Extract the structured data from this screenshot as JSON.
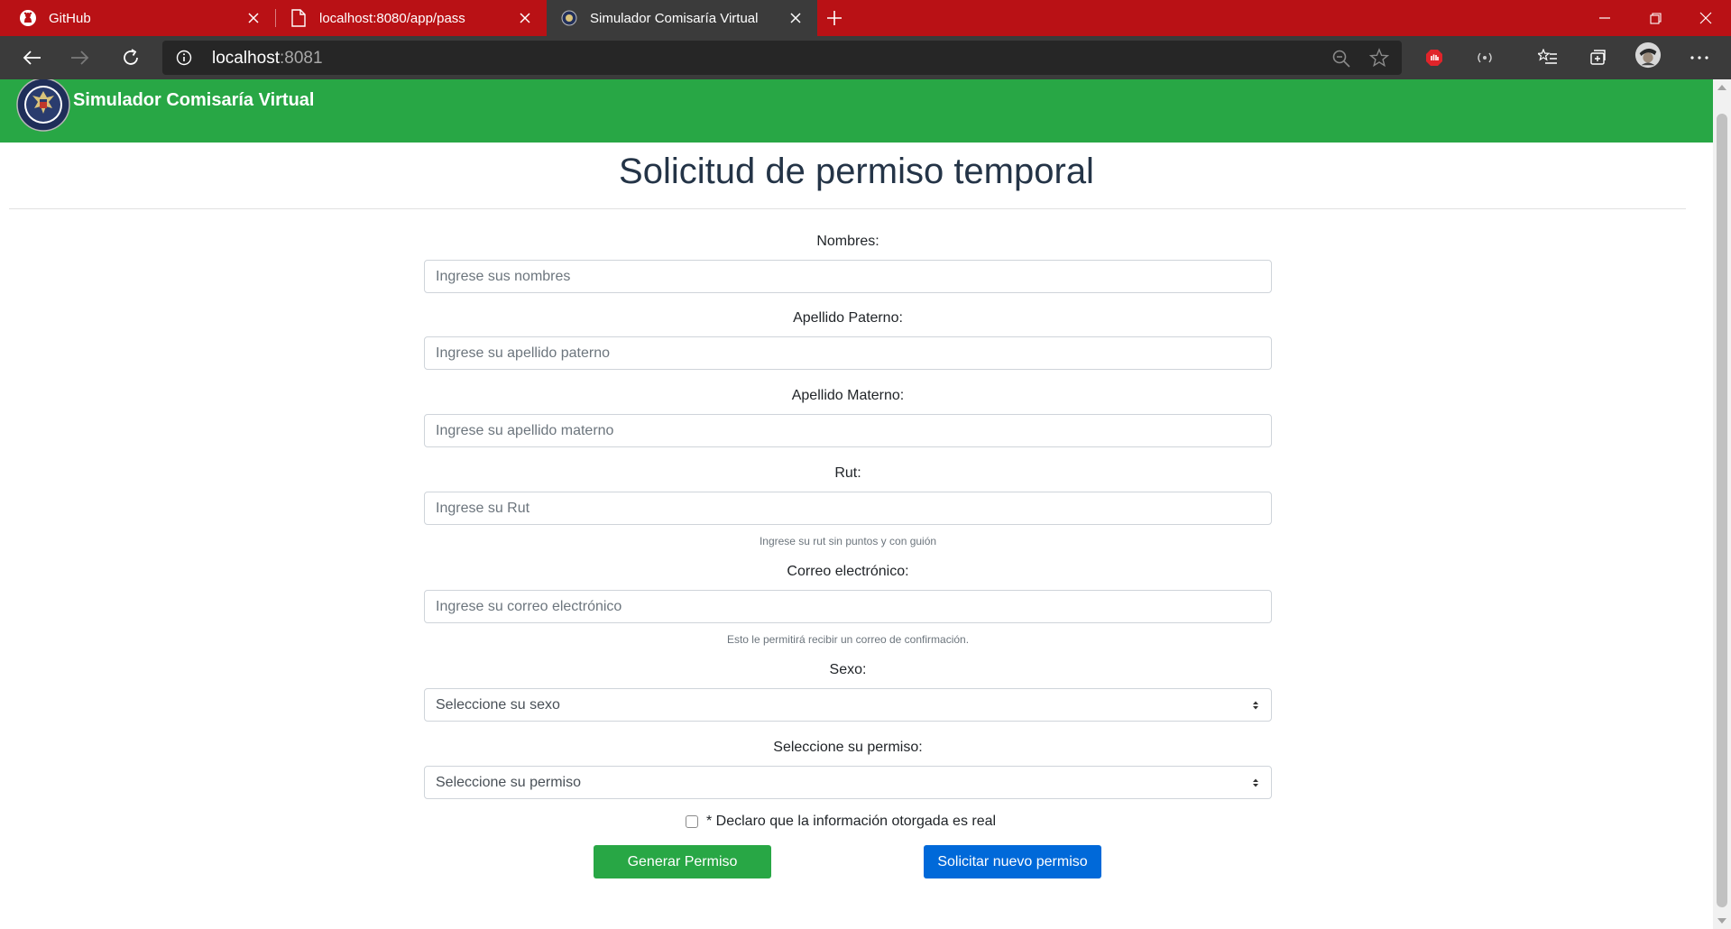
{
  "browser": {
    "tabs": [
      {
        "title": "GitHub",
        "icon": "github-icon"
      },
      {
        "title": "localhost:8080/app/pass",
        "icon": "page-icon"
      },
      {
        "title": "Simulador Comisaría Virtual",
        "icon": "seal-favicon",
        "active": true
      }
    ],
    "address": {
      "host": "localhost",
      "port": ":8081"
    },
    "colors": {
      "tabstrip": "#b91115",
      "toolbar": "#3b3b3b"
    }
  },
  "navbar": {
    "brand": "Simulador Comisaría Virtual",
    "color": "#28a745"
  },
  "page": {
    "title": "Solicitud de permiso temporal"
  },
  "form": {
    "nombres": {
      "label": "Nombres:",
      "placeholder": "Ingrese sus nombres"
    },
    "apellido_paterno": {
      "label": "Apellido Paterno:",
      "placeholder": "Ingrese su apellido paterno"
    },
    "apellido_materno": {
      "label": "Apellido Materno:",
      "placeholder": "Ingrese su apellido materno"
    },
    "rut": {
      "label": "Rut:",
      "placeholder": "Ingrese su Rut",
      "help": "Ingrese su rut sin puntos y con guión"
    },
    "correo": {
      "label": "Correo electrónico:",
      "placeholder": "Ingrese su correo electrónico",
      "help": "Esto le permitirá recibir un correo de confirmación."
    },
    "sexo": {
      "label": "Sexo:",
      "selected": "Seleccione su sexo"
    },
    "permiso": {
      "label": "Seleccione su permiso:",
      "selected": "Seleccione su permiso"
    },
    "declaracion": "* Declaro que la información otorgada es real",
    "buttons": {
      "generar": "Generar Permiso",
      "nuevo": "Solicitar nuevo permiso"
    }
  }
}
